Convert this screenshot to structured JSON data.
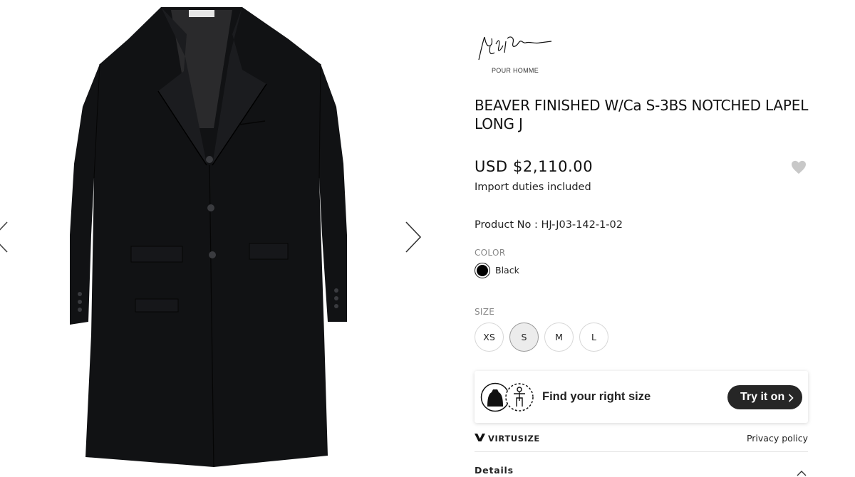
{
  "brand": {
    "logo_text": "Yohji Yamamoto",
    "sub_label": "POUR HOMME"
  },
  "gallery": {
    "image": "black-notched-lapel-long-coat",
    "prev_icon": "chevron-left-icon",
    "next_icon": "chevron-right-icon"
  },
  "product": {
    "title": "BEAVER FINISHED W/Ca S-3BS NOTCHED LAPEL LONG J",
    "price": "USD $2,110.00",
    "duties_note": "Import duties included",
    "product_no": "Product No : HJ-J03-142-1-02",
    "favorite_icon": "heart-icon"
  },
  "color": {
    "label": "COLOR",
    "selected_name": "Black",
    "swatch_hex": "#000000"
  },
  "size": {
    "label": "SIZE",
    "options": [
      "XS",
      "S",
      "M",
      "L"
    ],
    "selected": "S"
  },
  "virtusize": {
    "prompt": "Find your right size",
    "button_label": "Try it on",
    "brand_name": "VIRTUSIZE",
    "privacy_label": "Privacy policy"
  },
  "details": {
    "label": "Details"
  },
  "colors": {
    "text": "#222222",
    "muted_label": "#888888",
    "button_dark": "#262626",
    "heart": "#c8c8c8"
  }
}
